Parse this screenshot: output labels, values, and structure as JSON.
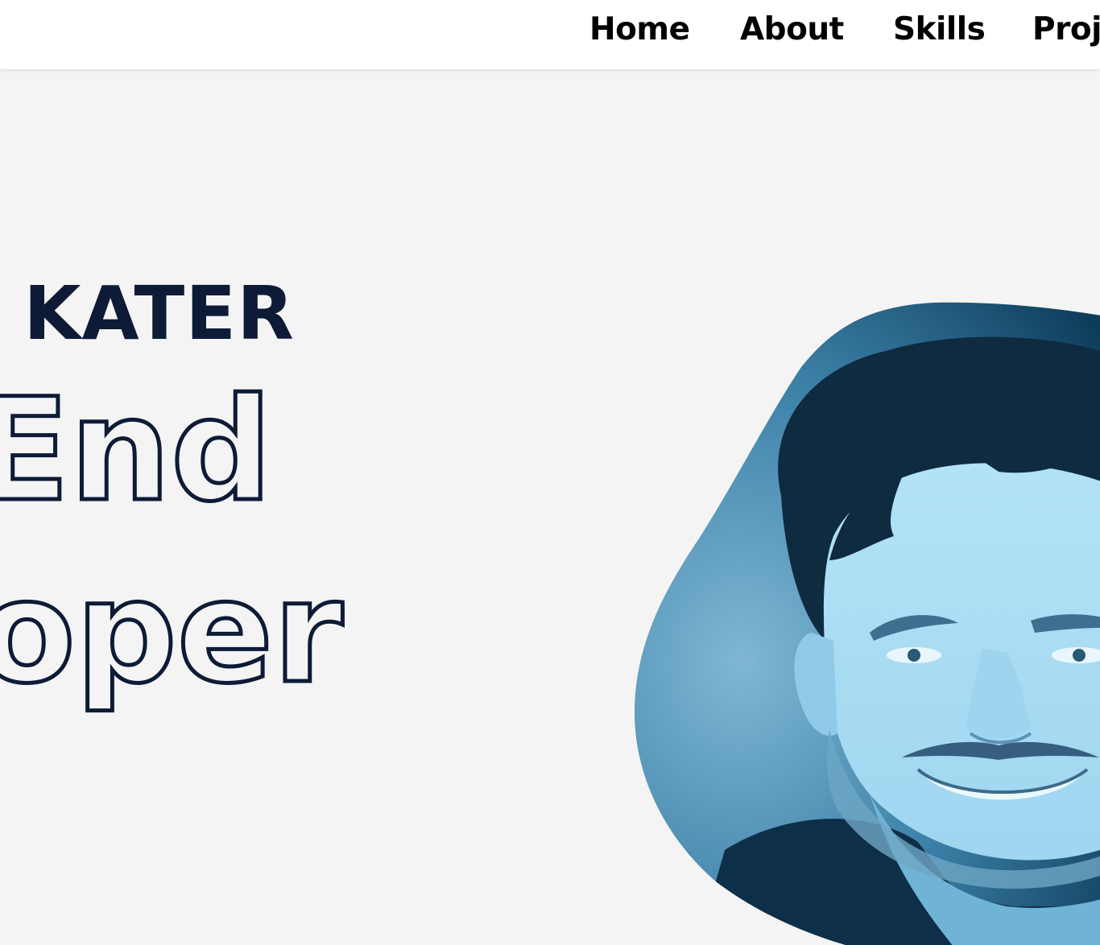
{
  "nav": {
    "items": [
      {
        "label": "Home"
      },
      {
        "label": "About"
      },
      {
        "label": "Skills"
      },
      {
        "label": "Proje"
      }
    ]
  },
  "hero": {
    "name": "Y KATER",
    "role_line1": "End",
    "role_line2": "oper"
  },
  "colors": {
    "navy": "#0d1b36",
    "page_bg": "#f4f4f4",
    "nav_bg": "#ffffff",
    "photo_light": "#a9dcf4",
    "photo_dark": "#0e3d5b"
  },
  "icons": {
    "portrait": "profile-photo-blob"
  }
}
